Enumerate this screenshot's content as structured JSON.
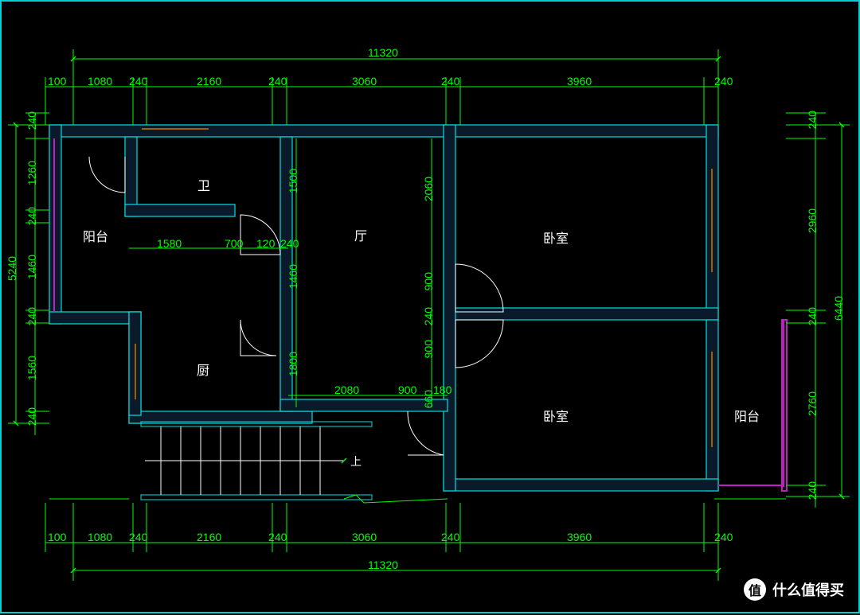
{
  "rooms": {
    "balcony1": "阳台",
    "bathroom": "卫",
    "hall": "厅",
    "bedroom1": "卧室",
    "bedroom2": "卧室",
    "kitchen": "厨",
    "balcony2": "阳台",
    "stair_up": "上"
  },
  "dims_top": {
    "overall": "11320",
    "d1": "100",
    "d2": "1080",
    "d3": "240",
    "d4": "2160",
    "d5": "240",
    "d6": "3060",
    "d7": "240",
    "d8": "3960",
    "d9": "240"
  },
  "dims_bottom": {
    "overall": "11320",
    "d1": "100",
    "d2": "1080",
    "d3": "240",
    "d4": "2160",
    "d5": "240",
    "d6": "3060",
    "d7": "240",
    "d8": "3960",
    "d9": "240"
  },
  "dims_left": {
    "overall": "5240",
    "d1": "240",
    "d2": "1260",
    "d3": "240",
    "d4": "1460",
    "d5": "240",
    "d6": "1560",
    "d7": "240"
  },
  "dims_right": {
    "overall": "6440",
    "d1": "240",
    "d2": "2960",
    "d3": "240",
    "d4": "2760",
    "d5": "240"
  },
  "dims_inner": {
    "bath_w1": "1580",
    "bath_w2": "700",
    "bath_w3": "120",
    "bath_w4": "240",
    "hall_h1": "1500",
    "hall_h2": "1460",
    "hall_h3": "1800",
    "hall_w1": "2080",
    "hall_w2": "900",
    "hall_w3": "180",
    "br_h1": "2060",
    "br_h2": "900",
    "br_h3": "240",
    "br_h4": "900",
    "br_h5": "660"
  },
  "watermark": "什么值得买",
  "watermark_badge": "值"
}
